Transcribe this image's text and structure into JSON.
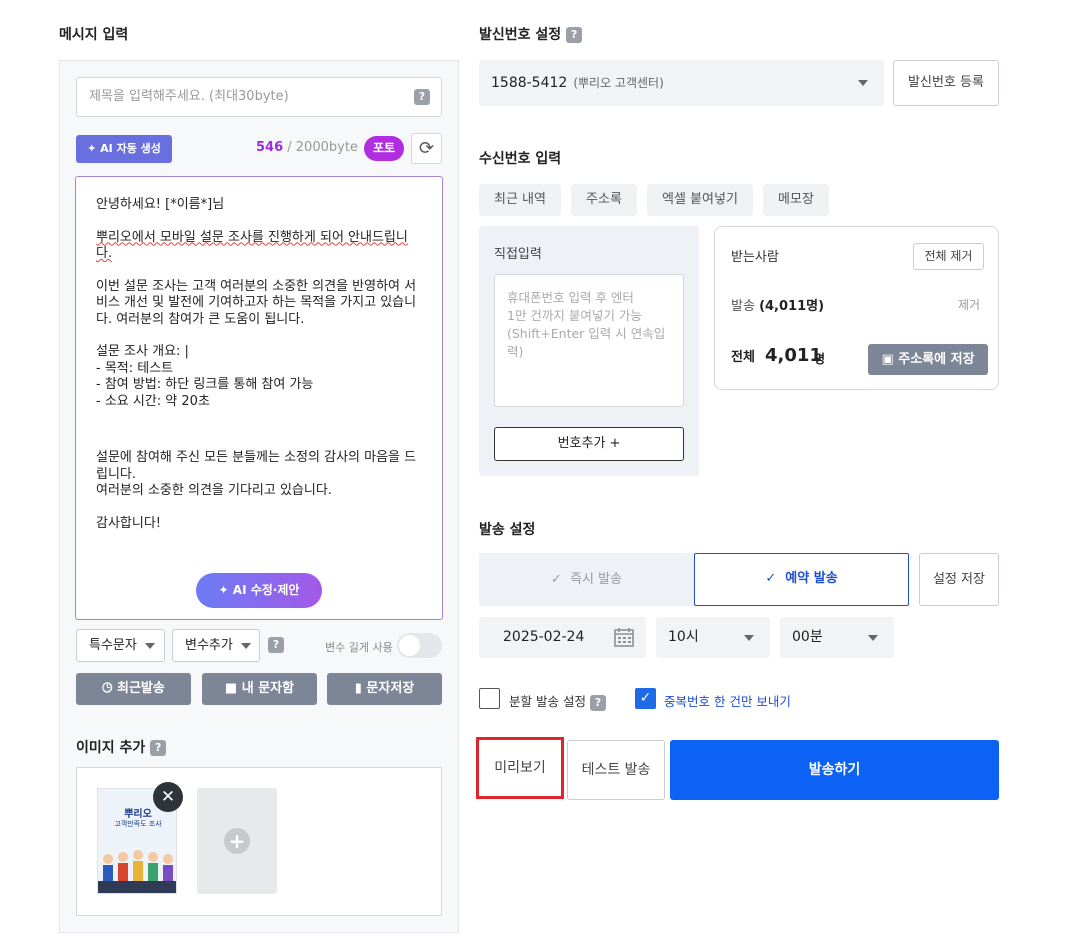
{
  "message": {
    "section_title": "메시지 입력",
    "subject_placeholder": "제목을 입력해주세요. (최대30byte)",
    "ai_generate_label": "AI 자동 생성",
    "byte_current": "546",
    "byte_max": " / 2000byte",
    "photo_badge": "포토",
    "body_lines": [
      "안녕하세요! [*이름*]님",
      "뿌리오에서 모바일 설문 조사를 진행하게 되어 안내드립니다.",
      "이번 설문 조사는 고객 여러분의 소중한 의견을 반영하여 서비스 개선 및 발전에 기여하고자 하는 목적을 가지고 있습니다. 여러분의 참여가 큰 도움이 됩니다.",
      "설문 조사 개요: |\n- 목적: 테스트\n- 참여 방법: 하단 링크를 통해 참여 가능\n- 소요 시간: 약 20초",
      "설문에 참여해 주신 모든 분들께는 소정의 감사의 마음을 드립니다.\n여러분의 소중한 의견을 기다리고 있습니다.",
      "감사합니다!"
    ],
    "ai_edit_label": "AI 수정·제안",
    "special_char_label": "특수문자",
    "add_variable_label": "변수추가",
    "variable_length_label": "변수 길게 사용",
    "recent_send_label": "최근발송",
    "my_messages_label": "내 문자함",
    "save_message_label": "문자저장"
  },
  "image": {
    "section_title": "이미지 추가",
    "thumb_title": "뿌리오",
    "thumb_subtitle": "고객만족도 조사"
  },
  "sender": {
    "section_title": "발신번호 설정",
    "number": "1588-5412",
    "hint": "(뿌리오 고객센터)",
    "register_label": "발신번호 등록"
  },
  "recipients": {
    "section_title": "수신번호 입력",
    "tabs": [
      "최근 내역",
      "주소록",
      "엑셀 붙여넣기",
      "메모장"
    ],
    "direct_title": "직접입력",
    "phone_placeholder": "휴대폰번호 입력 후 엔터\n1만 건까지 붙여넣기 가능\n(Shift+Enter 입력 시 연속입력)",
    "add_number_label": "번호추가 +",
    "receiver_title": "받는사람",
    "clear_all_label": "전체 제거",
    "send_label": "발송",
    "send_count": "(4,011명)",
    "remove_label": "제거",
    "total_label": "전체",
    "total_count": "4,011",
    "total_unit": "명",
    "save_addressbook_label": "주소록에 저장"
  },
  "send_settings": {
    "section_title": "발송 설정",
    "instant_label": "즉시 발송",
    "reserve_label": "예약 발송",
    "save_settings_label": "설정 저장",
    "date": "2025-02-24",
    "hour": "10시",
    "minute": "00분",
    "split_label": "분할 발송 설정",
    "dedupe_label": "중복번호 한 건만 보내기"
  },
  "actions": {
    "preview_label": "미리보기",
    "test_label": "테스트 발송",
    "send_label": "발송하기"
  }
}
